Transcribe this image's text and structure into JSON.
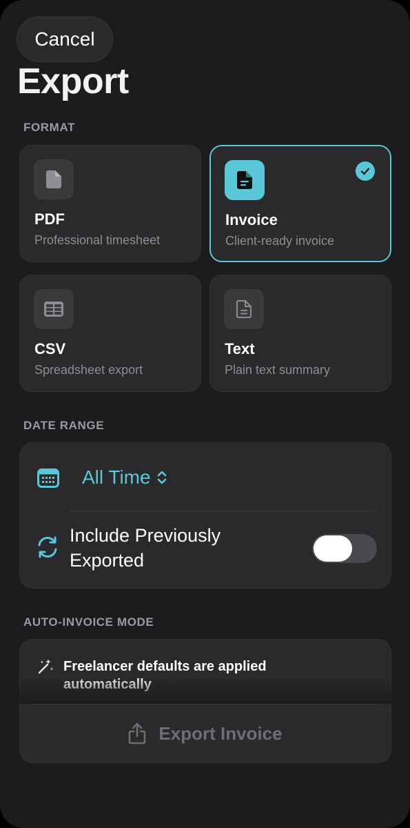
{
  "header": {
    "cancel_label": "Cancel",
    "title": "Export"
  },
  "sections": {
    "format": "FORMAT",
    "date_range": "DATE RANGE",
    "auto_invoice": "AUTO-INVOICE MODE"
  },
  "formats": [
    {
      "name": "PDF",
      "description": "Professional timesheet",
      "icon": "document-icon",
      "selected": false
    },
    {
      "name": "Invoice",
      "description": "Client-ready invoice",
      "icon": "invoice-icon",
      "selected": true
    },
    {
      "name": "CSV",
      "description": "Spreadsheet export",
      "icon": "table-icon",
      "selected": false
    },
    {
      "name": "Text",
      "description": "Plain text summary",
      "icon": "text-document-icon",
      "selected": false
    }
  ],
  "date_range": {
    "value": "All Time",
    "include_previously_exported_label": "Include Previously Exported",
    "include_previously_exported": false
  },
  "auto_invoice": {
    "message": "Freelancer defaults are applied automatically"
  },
  "footer": {
    "export_label": "Export Invoice"
  },
  "colors": {
    "accent": "#5ac8d8",
    "background": "#1c1c1e",
    "card": "#2a2a2c",
    "disabled_text": "#6e6e73"
  }
}
